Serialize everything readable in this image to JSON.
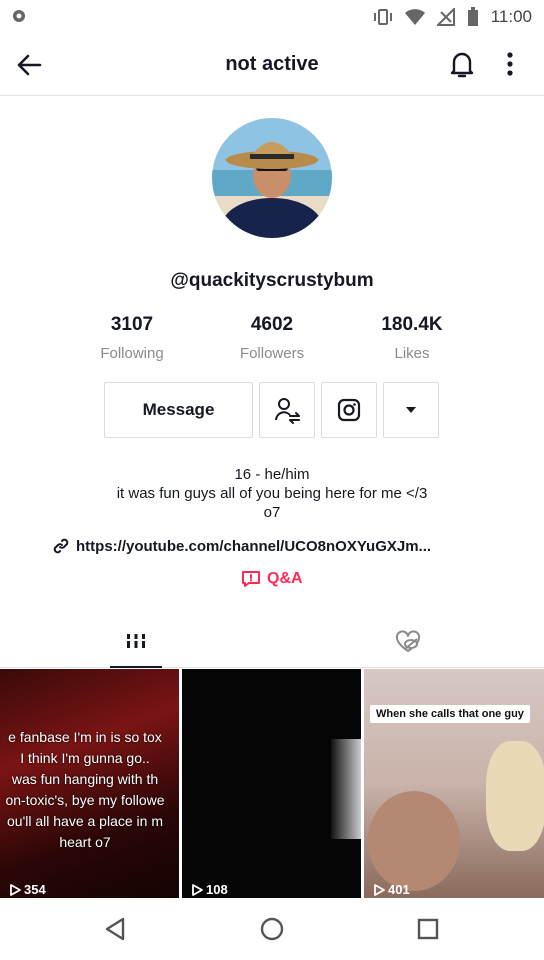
{
  "status_bar": {
    "time": "11:00"
  },
  "header": {
    "title": "not active"
  },
  "profile": {
    "username": "@quackityscrustybum",
    "stats": [
      {
        "value": "3107",
        "label": "Following"
      },
      {
        "value": "4602",
        "label": "Followers"
      },
      {
        "value": "180.4K",
        "label": "Likes"
      }
    ],
    "message_label": "Message",
    "bio": [
      "16 - he/him",
      "it was fun guys all of you being here for me </3",
      "o7"
    ],
    "link": "https://youtube.com/channel/UCO8nOXYuGXJm...",
    "qa_label": "Q&A"
  },
  "videos": [
    {
      "views": "354",
      "caption": [
        "e fanbase I'm in is so tox",
        "I think I'm gunna go..",
        "was fun hanging with th",
        "on-toxic's, bye my followe",
        "ou'll all have a place in m",
        "heart o7"
      ]
    },
    {
      "views": "108"
    },
    {
      "views": "401",
      "caption": "When she calls that one guy"
    }
  ],
  "colors": {
    "accent": "#fe2c55",
    "text": "#161823",
    "muted": "#8a8b91"
  }
}
